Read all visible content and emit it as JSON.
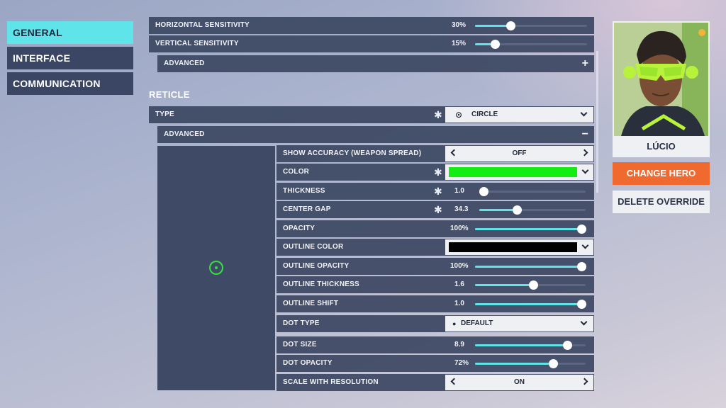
{
  "nav": {
    "items": [
      {
        "label": "GENERAL",
        "active": true
      },
      {
        "label": "INTERFACE",
        "active": false
      },
      {
        "label": "COMMUNICATION",
        "active": false
      }
    ]
  },
  "sensitivity": {
    "horizontal": {
      "label": "HORIZONTAL SENSITIVITY",
      "value": "30%",
      "fraction": 0.3
    },
    "vertical": {
      "label": "VERTICAL SENSITIVITY",
      "value": "15%",
      "fraction": 0.15
    },
    "advanced_label": "ADVANCED",
    "advanced_toggle": "+"
  },
  "reticle": {
    "section_title": "RETICLE",
    "type_label": "TYPE",
    "type_value": "CIRCLE",
    "advanced_label": "ADVANCED",
    "advanced_toggle": "−",
    "show_accuracy": {
      "label": "SHOW ACCURACY (WEAPON SPREAD)",
      "value": "OFF"
    },
    "color": {
      "label": "COLOR",
      "swatch": "#12ee12"
    },
    "thickness": {
      "label": "THICKNESS",
      "value": "1.0",
      "fraction": 0.0
    },
    "center_gap": {
      "label": "CENTER GAP",
      "value": "34.3",
      "fraction": 0.343
    },
    "opacity": {
      "label": "OPACITY",
      "value": "100%",
      "fraction": 1.0
    },
    "outline_color": {
      "label": "OUTLINE COLOR",
      "swatch": "#000000"
    },
    "outline_opacity": {
      "label": "OUTLINE OPACITY",
      "value": "100%",
      "fraction": 1.0
    },
    "outline_thickness": {
      "label": "OUTLINE THICKNESS",
      "value": "1.6",
      "fraction": 0.53
    },
    "outline_shift": {
      "label": "OUTLINE SHIFT",
      "value": "1.0",
      "fraction": 1.0
    },
    "dot_type": {
      "label": "DOT TYPE",
      "value": "DEFAULT"
    },
    "dot_size": {
      "label": "DOT SIZE",
      "value": "8.9",
      "fraction": 0.86
    },
    "dot_opacity": {
      "label": "DOT OPACITY",
      "value": "72%",
      "fraction": 0.72
    },
    "scale": {
      "label": "SCALE WITH RESOLUTION",
      "value": "ON"
    },
    "preview_color": "#31e23a"
  },
  "hero": {
    "name": "LÚCIO",
    "change_label": "CHANGE HERO",
    "delete_label": "DELETE OVERRIDE"
  },
  "colors": {
    "accent": "#5fe4ea",
    "orange": "#f06a2f"
  },
  "icons": {
    "asterisk": "✱",
    "circle_type": "⊙",
    "dot": "●"
  }
}
